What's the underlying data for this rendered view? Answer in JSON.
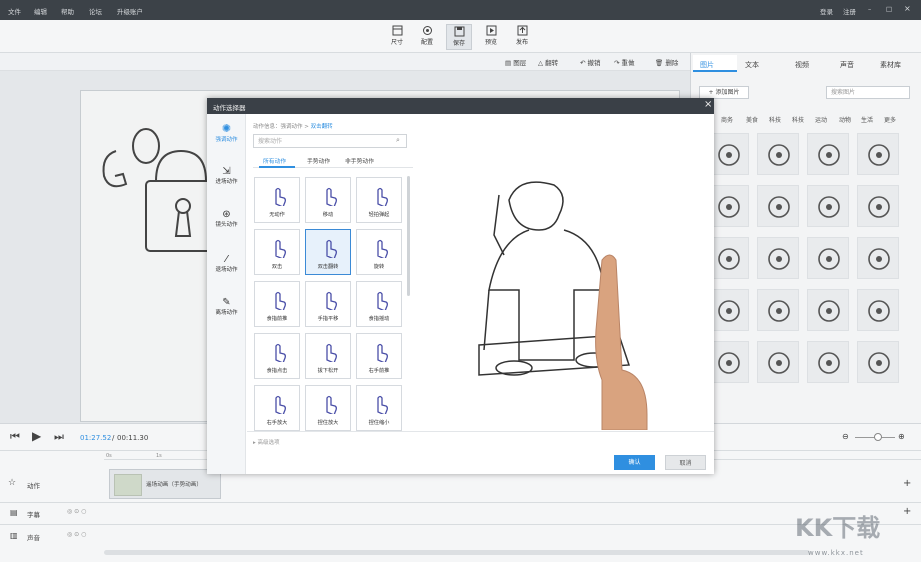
{
  "menubar": {
    "items": [
      "文件",
      "编辑",
      "帮助",
      "论坛",
      "升级账户"
    ],
    "login": "登录",
    "register": "注册"
  },
  "toolbar": {
    "buttons": [
      {
        "label": "尺寸",
        "icon": "size-icon"
      },
      {
        "label": "配置",
        "icon": "config-icon"
      },
      {
        "label": "保存",
        "icon": "save-icon"
      },
      {
        "label": "预览",
        "icon": "preview-icon"
      },
      {
        "label": "发布",
        "icon": "publish-icon"
      }
    ]
  },
  "subtoolbar": {
    "items": [
      "图层",
      "翻转",
      "撤销",
      "重做",
      "删除"
    ]
  },
  "right_panel": {
    "tabs": [
      "图片",
      "文本",
      "视频",
      "声音",
      "素材库"
    ],
    "add_image": "+ 添加图片",
    "search_placeholder": "搜索图片",
    "categories": [
      "商务",
      "美食",
      "科技",
      "科技",
      "运动",
      "动物",
      "生活",
      "更多"
    ],
    "accent": "#2f8fe0"
  },
  "dialog": {
    "title": "动作选择器",
    "close": "×",
    "sidebar": [
      "强调动作",
      "进场动作",
      "镜头动作",
      "退场动作",
      "离场动作"
    ],
    "breadcrumb": {
      "prefix": "动作信息：强调动作 > ",
      "current": "双击翻转"
    },
    "search_placeholder": "搜索动作",
    "tabs": [
      "所有动作",
      "手势动作",
      "非手势动作"
    ],
    "actions": [
      [
        "无动作",
        "移动",
        "轻拍弹起"
      ],
      [
        "双击",
        "双击翻转",
        "旋转"
      ],
      [
        "食指前推",
        "手指平移",
        "食指摇动"
      ],
      [
        "食指点击",
        "拔下松开",
        "右手前推"
      ],
      [
        "右手放大",
        "捏住放大",
        "捏住缩小"
      ]
    ],
    "advanced": "高级选项",
    "confirm": "确认",
    "cancel": "取消"
  },
  "timeline": {
    "current_time": "01:27.52",
    "total_time": "00:11.30",
    "tracks": [
      "动作",
      "字幕",
      "声音"
    ],
    "clip_label": "遥场动画（手势动画）",
    "ruler_marks": [
      "0s",
      "1s"
    ]
  },
  "watermark": {
    "logo": "KK下载",
    "url": "www.kkx.net"
  }
}
